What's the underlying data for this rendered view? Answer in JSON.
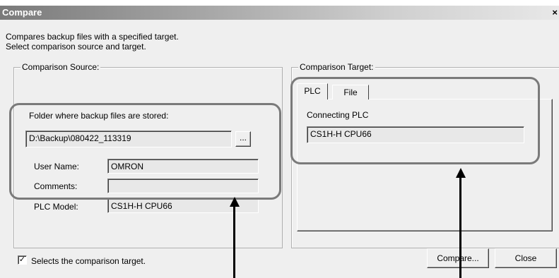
{
  "window": {
    "title": "Compare",
    "close_glyph": "×"
  },
  "description": {
    "line1": "Compares backup files with a specified target.",
    "line2": "Select comparison source and target."
  },
  "source": {
    "legend": "Comparison Source:",
    "folder_label": "Folder where backup files are stored:",
    "folder_value": "D:\\Backup\\080422_113319",
    "browse_label": "...",
    "user_name_label": "User Name:",
    "user_name_value": "OMRON",
    "comments_label": "Comments:",
    "comments_value": "",
    "plc_model_label": "PLC Model:",
    "plc_model_value": "CS1H-H CPU66"
  },
  "target": {
    "legend": "Comparison Target:",
    "tabs": [
      "PLC",
      "File"
    ],
    "active_tab": "PLC",
    "connecting_label": "Connecting PLC",
    "connecting_value": "CS1H-H CPU66"
  },
  "footer": {
    "checkbox_label": "Selects the comparison target.",
    "checkbox_checked": true,
    "check_glyph": "✓",
    "compare_label": "Compare...",
    "close_label": "Close"
  }
}
